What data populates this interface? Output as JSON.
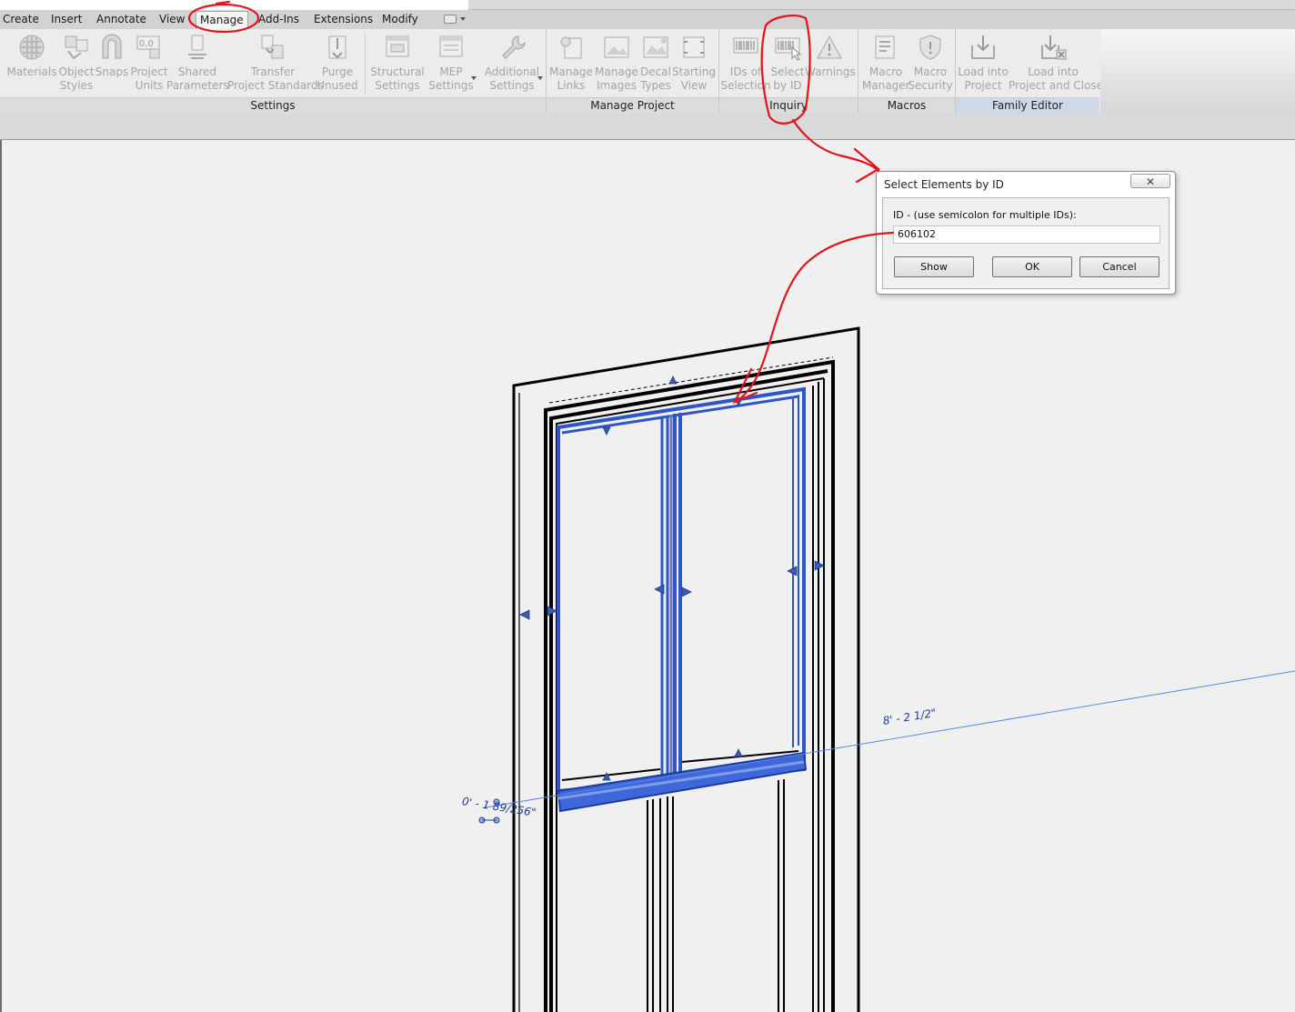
{
  "tabs": [
    {
      "label": "Create",
      "active": false
    },
    {
      "label": "Insert",
      "active": false
    },
    {
      "label": "Annotate",
      "active": false
    },
    {
      "label": "View",
      "active": false
    },
    {
      "label": "Manage",
      "active": true
    },
    {
      "label": "Add-Ins",
      "active": false
    },
    {
      "label": "Extensions",
      "active": false
    },
    {
      "label": "Modify",
      "active": false
    }
  ],
  "ribbon": {
    "settings": {
      "title": "Settings",
      "buttons": [
        {
          "line1": "Materials",
          "line2": "",
          "icon": "materials-icon"
        },
        {
          "line1": "Object",
          "line2": "Styles",
          "icon": "object-styles-icon"
        },
        {
          "line1": "Snaps",
          "line2": "",
          "icon": "snaps-icon"
        },
        {
          "line1": "Project",
          "line2": "Units",
          "icon": "project-units-icon"
        },
        {
          "line1": "Shared",
          "line2": "Parameters",
          "icon": "shared-parameters-icon"
        },
        {
          "line1": "Transfer",
          "line2": "Project Standards",
          "icon": "transfer-standards-icon"
        },
        {
          "line1": "Purge",
          "line2": "Unused",
          "icon": "purge-unused-icon"
        },
        {
          "line1": "Structural",
          "line2": "Settings",
          "icon": "structural-settings-icon"
        },
        {
          "line1": "MEP",
          "line2": "Settings",
          "icon": "mep-settings-icon"
        },
        {
          "line1": "Additional",
          "line2": "Settings",
          "icon": "additional-settings-icon"
        }
      ]
    },
    "manage_project": {
      "title": "Manage Project",
      "buttons": [
        {
          "line1": "Manage",
          "line2": "Links",
          "icon": "manage-links-icon"
        },
        {
          "line1": "Manage",
          "line2": "Images",
          "icon": "manage-images-icon"
        },
        {
          "line1": "Decal",
          "line2": "Types",
          "icon": "decal-types-icon"
        },
        {
          "line1": "Starting",
          "line2": "View",
          "icon": "starting-view-icon"
        }
      ]
    },
    "inquiry": {
      "title": "Inquiry",
      "buttons": [
        {
          "line1": "IDs of",
          "line2": "Selection",
          "icon": "ids-of-selection-icon"
        },
        {
          "line1": "Select",
          "line2": "by ID",
          "icon": "select-by-id-icon"
        },
        {
          "line1": "Warnings",
          "line2": "",
          "icon": "warnings-icon"
        }
      ]
    },
    "macros": {
      "title": "Macros",
      "buttons": [
        {
          "line1": "Macro",
          "line2": "Manager",
          "icon": "macro-manager-icon"
        },
        {
          "line1": "Macro",
          "line2": "Security",
          "icon": "macro-security-icon"
        }
      ]
    },
    "family_editor": {
      "title": "Family Editor",
      "buttons": [
        {
          "line1": "Load into",
          "line2": "Project",
          "icon": "load-into-project-icon"
        },
        {
          "line1": "Load into",
          "line2": "Project and Close",
          "icon": "load-into-project-close-icon"
        }
      ]
    }
  },
  "dialog": {
    "title": "Select Elements by ID",
    "close_glyph": "✕",
    "label": "ID - (use semicolon for multiple IDs):",
    "value": "606102",
    "buttons": {
      "show": "Show",
      "ok": "OK",
      "cancel": "Cancel"
    }
  },
  "dimensions": {
    "top": "8' - 2 1/2\"",
    "bottom": "0' - 1 89/256\""
  },
  "colors": {
    "selection": "#2f56c6",
    "annotation": "#e0141b",
    "dimension": "#1a3f95"
  }
}
